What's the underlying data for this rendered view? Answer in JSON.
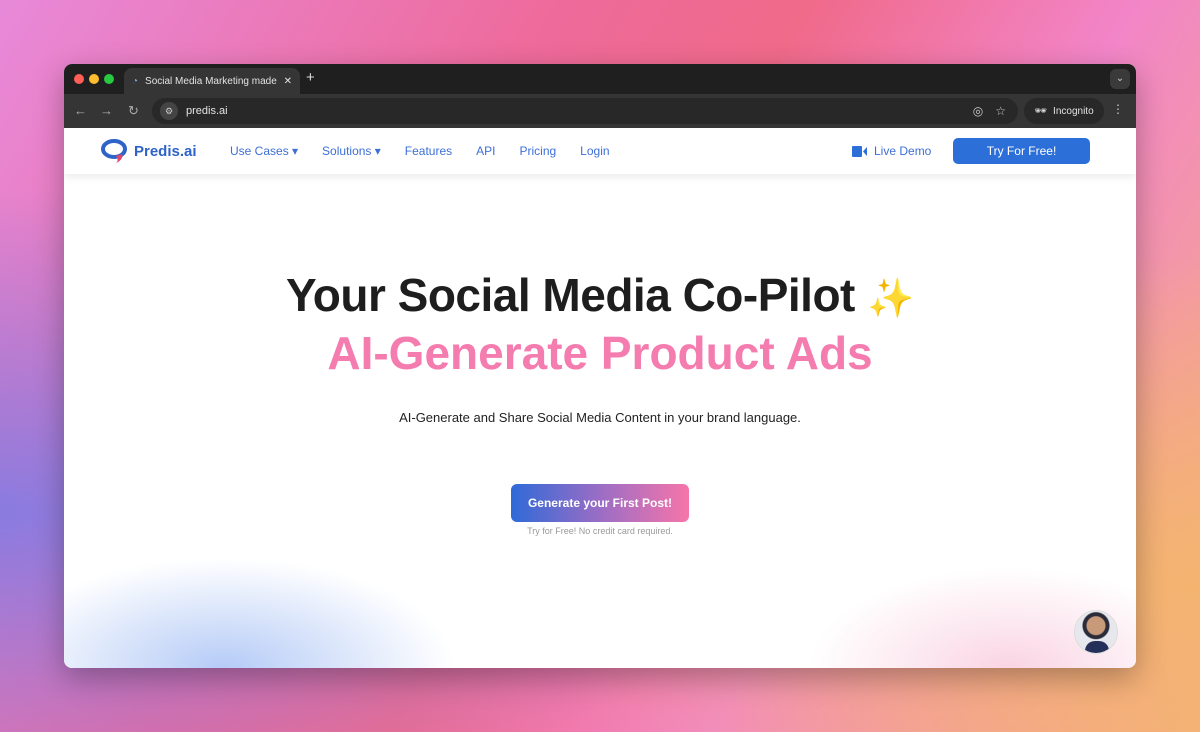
{
  "browser": {
    "tab_title": "Social Media Marketing made",
    "url": "predis.ai",
    "incognito_label": "Incognito",
    "new_tab": "+",
    "close_tab": "✕"
  },
  "site": {
    "logo": "Predis.ai",
    "menu": [
      "Use Cases ▾",
      "Solutions ▾",
      "Features",
      "API",
      "Pricing",
      "Login"
    ],
    "live_demo": "Live Demo",
    "try_free": "Try For Free!"
  },
  "hero": {
    "title": "Your Social Media Co-Pilot",
    "sparkle": "✨",
    "subtitle_rotating": "AI-Generate Product Ads",
    "description": "AI-Generate and Share Social Media Content in your brand language.",
    "cta": "Generate your First Post!",
    "note": "Try for Free! No credit card required."
  },
  "colors": {
    "accent": "#2d6fd9",
    "pink": "#f47cae"
  }
}
